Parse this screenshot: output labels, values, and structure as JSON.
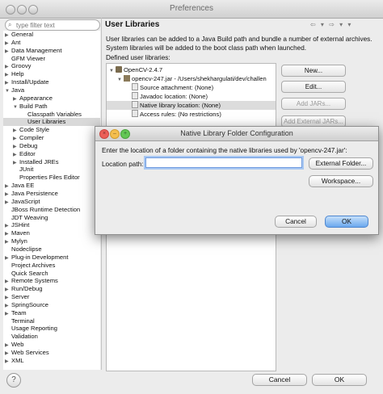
{
  "window": {
    "title": "Preferences"
  },
  "filter": {
    "placeholder": "type filter text"
  },
  "tree": [
    {
      "label": "General",
      "toggle": "▶",
      "indent": 0
    },
    {
      "label": "Ant",
      "toggle": "▶",
      "indent": 0
    },
    {
      "label": "Data Management",
      "toggle": "▶",
      "indent": 0
    },
    {
      "label": "GFM Viewer",
      "toggle": "",
      "indent": 0
    },
    {
      "label": "Groovy",
      "toggle": "▶",
      "indent": 0
    },
    {
      "label": "Help",
      "toggle": "▶",
      "indent": 0
    },
    {
      "label": "Install/Update",
      "toggle": "▶",
      "indent": 0
    },
    {
      "label": "Java",
      "toggle": "▼",
      "indent": 0
    },
    {
      "label": "Appearance",
      "toggle": "▶",
      "indent": 1
    },
    {
      "label": "Build Path",
      "toggle": "▼",
      "indent": 1
    },
    {
      "label": "Classpath Variables",
      "toggle": "",
      "indent": 2
    },
    {
      "label": "User Libraries",
      "toggle": "",
      "indent": 2,
      "selected": true
    },
    {
      "label": "Code Style",
      "toggle": "▶",
      "indent": 1
    },
    {
      "label": "Compiler",
      "toggle": "▶",
      "indent": 1
    },
    {
      "label": "Debug",
      "toggle": "▶",
      "indent": 1
    },
    {
      "label": "Editor",
      "toggle": "▶",
      "indent": 1
    },
    {
      "label": "Installed JREs",
      "toggle": "▶",
      "indent": 1
    },
    {
      "label": "JUnit",
      "toggle": "",
      "indent": 1
    },
    {
      "label": "Properties Files Editor",
      "toggle": "",
      "indent": 1
    },
    {
      "label": "Java EE",
      "toggle": "▶",
      "indent": 0
    },
    {
      "label": "Java Persistence",
      "toggle": "▶",
      "indent": 0
    },
    {
      "label": "JavaScript",
      "toggle": "▶",
      "indent": 0
    },
    {
      "label": "JBoss Runtime Detection",
      "toggle": "",
      "indent": 0
    },
    {
      "label": "JDT Weaving",
      "toggle": "",
      "indent": 0
    },
    {
      "label": "JSHint",
      "toggle": "▶",
      "indent": 0
    },
    {
      "label": "Maven",
      "toggle": "▶",
      "indent": 0
    },
    {
      "label": "Mylyn",
      "toggle": "▶",
      "indent": 0
    },
    {
      "label": "Nodeclipse",
      "toggle": "",
      "indent": 0
    },
    {
      "label": "Plug-in Development",
      "toggle": "▶",
      "indent": 0
    },
    {
      "label": "Project Archives",
      "toggle": "",
      "indent": 0
    },
    {
      "label": "Quick Search",
      "toggle": "",
      "indent": 0
    },
    {
      "label": "Remote Systems",
      "toggle": "▶",
      "indent": 0
    },
    {
      "label": "Run/Debug",
      "toggle": "▶",
      "indent": 0
    },
    {
      "label": "Server",
      "toggle": "▶",
      "indent": 0
    },
    {
      "label": "SpringSource",
      "toggle": "▶",
      "indent": 0
    },
    {
      "label": "Team",
      "toggle": "▶",
      "indent": 0
    },
    {
      "label": "Terminal",
      "toggle": "",
      "indent": 0
    },
    {
      "label": "Usage Reporting",
      "toggle": "",
      "indent": 0
    },
    {
      "label": "Validation",
      "toggle": "",
      "indent": 0
    },
    {
      "label": "Web",
      "toggle": "▶",
      "indent": 0
    },
    {
      "label": "Web Services",
      "toggle": "▶",
      "indent": 0
    },
    {
      "label": "XML",
      "toggle": "▶",
      "indent": 0
    }
  ],
  "right": {
    "heading": "User Libraries",
    "nav_arrows": "⇦ ▾ ⇨ ▾ ▾",
    "description": "User libraries can be added to a Java Build path and bundle a number of external archives. System libraries will be added to the boot class path when launched.",
    "defined_label": "Defined user libraries:",
    "libraries": [
      {
        "label": "OpenCV-2.4.7",
        "toggle": "▼",
        "indent": 0,
        "icon": "library-icon"
      },
      {
        "label": "opencv-247.jar - /Users/shekhargulati/dev/challen",
        "toggle": "▼",
        "indent": 1,
        "icon": "jar-icon"
      },
      {
        "label": "Source attachment: (None)",
        "toggle": "",
        "indent": 2,
        "icon": "doc-icon"
      },
      {
        "label": "Javadoc location: (None)",
        "toggle": "",
        "indent": 2,
        "icon": "doc-icon"
      },
      {
        "label": "Native library location: (None)",
        "toggle": "",
        "indent": 2,
        "icon": "doc-icon",
        "selected": true
      },
      {
        "label": "Access rules: (No restrictions)",
        "toggle": "",
        "indent": 2,
        "icon": "doc-icon"
      }
    ],
    "buttons": {
      "new": "New...",
      "edit": "Edit...",
      "add_jars": "Add JARs...",
      "add_external_jars": "Add External JARs..."
    }
  },
  "bottom": {
    "help": "?",
    "cancel": "Cancel",
    "ok": "OK"
  },
  "dialog": {
    "title": "Native Library Folder Configuration",
    "message": "Enter the location of a folder containing the native libraries used by 'opencv-247.jar':",
    "location_label": "Location path:",
    "location_value": "",
    "external_folder": "External Folder...",
    "workspace": "Workspace...",
    "cancel": "Cancel",
    "ok": "OK"
  }
}
